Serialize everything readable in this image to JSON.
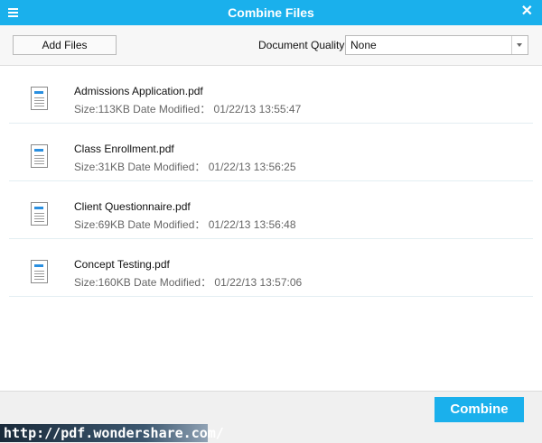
{
  "window": {
    "title": "Combine Files",
    "menu_icon": "hamburger-menu-icon",
    "close_icon": "close-icon",
    "close_glyph": "✕"
  },
  "toolbar": {
    "add_files_label": "Add Files",
    "quality_label": "Document Quality:",
    "quality_value": "None"
  },
  "files": [
    {
      "name": "Admissions Application.pdf",
      "meta": "Size:113KB Date Modified： 01/22/13 13:55:47"
    },
    {
      "name": "Class Enrollment.pdf",
      "meta": "Size:31KB Date Modified： 01/22/13 13:56:25"
    },
    {
      "name": "Client Questionnaire.pdf",
      "meta": "Size:69KB Date Modified： 01/22/13 13:56:48"
    },
    {
      "name": "Concept Testing.pdf",
      "meta": "Size:160KB Date Modified： 01/22/13 13:57:06"
    }
  ],
  "footer": {
    "combine_label": "Combine"
  },
  "watermark": {
    "url": "http://pdf.wondershare.com/"
  },
  "colors": {
    "accent": "#1ab0ec"
  }
}
